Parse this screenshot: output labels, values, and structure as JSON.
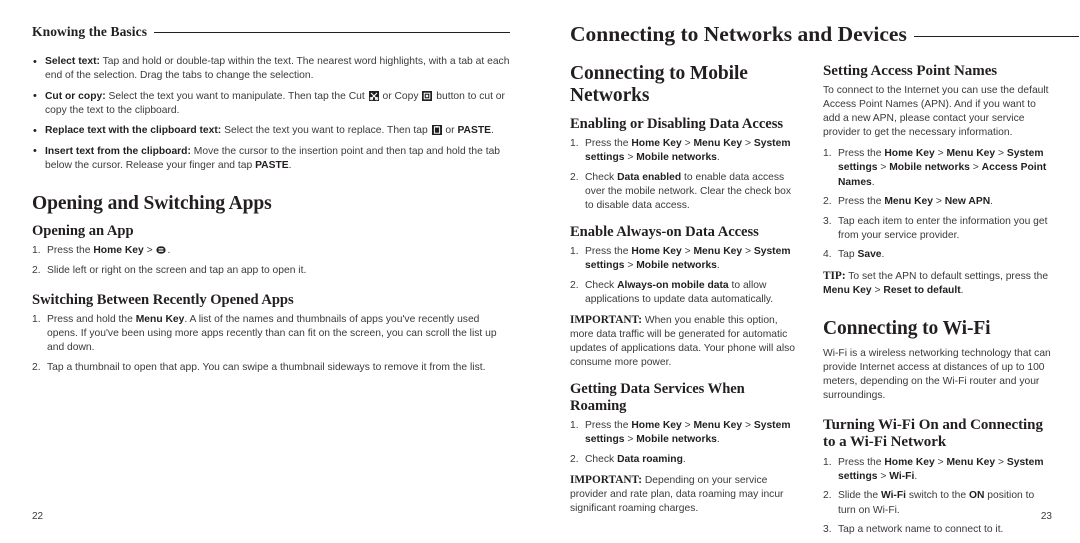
{
  "spread": {
    "left_page": {
      "running_head": "Knowing the Basics",
      "folio": "22",
      "bullets": [
        {
          "term": "Select text:",
          "text": " Tap and hold or double-tap within the text. The nearest word highlights, with a tab at each end of the selection. Drag the tabs to change the selection."
        },
        {
          "term": "Cut or copy:",
          "text": " Select the text you want to manipulate. Then tap the Cut ",
          "icon1": "cut-icon",
          "text2": " or Copy ",
          "icon2": "copy-icon",
          "text3": " button to cut or copy the text to the clipboard."
        },
        {
          "term": "Replace text with the clipboard text:",
          "text": " Select the text you want to replace. Then tap ",
          "icon1": "paste-icon",
          "text2": " or ",
          "bold_tail": "PASTE",
          "text3": "."
        },
        {
          "term": "Insert text from the clipboard:",
          "text": " Move the cursor to the insertion point and then tap and hold the tab below the cursor. Release your finger and tap ",
          "bold_tail": "PASTE",
          "text3": "."
        }
      ],
      "section_title": "Opening and Switching Apps",
      "sub1": {
        "title": "Opening an App",
        "step1_a": "Press the ",
        "step1_key": "Home Key",
        "step1_gt": " > ",
        "step1_icon": "app-drawer-icon",
        "step1_b": ".",
        "step2": "Slide left or right on the screen and tap an app to open it."
      },
      "sub2": {
        "title": "Switching Between Recently Opened Apps",
        "step1_a": "Press and hold the ",
        "step1_key": "Menu Key",
        "step1_b": ". A list of the names and thumbnails of apps you've recently used opens. If you've been using more apps recently than can fit on the screen, you can scroll the list up and down.",
        "step2": "Tap a thumbnail to open that app. You can swipe a thumbnail sideways to remove it from the list."
      }
    },
    "right_page": {
      "running_head": "Connecting to Networks and Devices",
      "folio": "23",
      "col_left": {
        "section_title": "Connecting to Mobile Networks",
        "sub1": {
          "title": "Enabling or Disabling Data Access",
          "step1": {
            "a": "Press the ",
            "k1": "Home Key",
            "g1": " > ",
            "k2": "Menu Key",
            "g2": " > ",
            "k3": "System settings",
            "g3": " > ",
            "k4": "Mobile networks",
            "b": "."
          },
          "step2": {
            "a": "Check ",
            "k1": "Data enabled",
            "b": " to enable data access over the mobile network. Clear the check box to disable data access."
          }
        },
        "sub2": {
          "title": "Enable Always-on Data Access",
          "step1": {
            "a": "Press the ",
            "k1": "Home Key",
            "g1": " > ",
            "k2": "Menu Key",
            "g2": " > ",
            "k3": "System settings",
            "g3": " > ",
            "k4": "Mobile networks",
            "b": "."
          },
          "step2": {
            "a": "Check ",
            "k1": "Always-on mobile data",
            "b": " to allow applications to update data automatically."
          },
          "note_lead": "IMPORTANT:",
          "note_text": " When you enable this option, more data traffic will be generated for automatic updates of applications data. Your phone will also consume more power."
        },
        "sub3": {
          "title": "Getting Data Services When Roaming",
          "step1": {
            "a": "Press the ",
            "k1": "Home Key",
            "g1": " > ",
            "k2": "Menu Key",
            "g2": " > ",
            "k3": "System settings",
            "g3": " > ",
            "k4": "Mobile networks",
            "b": "."
          },
          "step2": {
            "a": "Check ",
            "k1": "Data roaming",
            "b": "."
          },
          "note_lead": "IMPORTANT:",
          "note_text": " Depending on your service provider and rate plan, data roaming may incur significant roaming charges."
        }
      },
      "col_right": {
        "sub1": {
          "title": "Setting Access Point Names",
          "intro": "To connect to the Internet you can use the default Access Point Names (APN). And if you want to add a new APN, please contact your service provider to get the necessary information.",
          "step1": {
            "a": "Press the ",
            "k1": "Home Key",
            "g1": " > ",
            "k2": "Menu Key",
            "g2": " > ",
            "k3": "System settings",
            "g3": " > ",
            "k4": "Mobile networks",
            "g4": " > ",
            "k5": "Access Point Names",
            "b": "."
          },
          "step2": {
            "a": "Press the ",
            "k1": "Menu Key",
            "g1": " > ",
            "k2": "New APN",
            "b": "."
          },
          "step3": {
            "a": "Tap each item to enter the information you get from your service provider."
          },
          "step4": {
            "a": "Tap ",
            "k1": "Save",
            "b": "."
          },
          "tip_lead": "TIP:",
          "tip_text": " To set the APN to default settings, press the ",
          "tip_k1": "Menu Key",
          "tip_g1": " > ",
          "tip_k2": "Reset to default",
          "tip_tail": "."
        },
        "section_title": "Connecting to Wi-Fi",
        "section_intro": "Wi-Fi is a wireless networking technology that can provide Internet access at distances of up to 100 meters, depending on the Wi-Fi router and your surroundings.",
        "sub2": {
          "title": "Turning Wi-Fi On and Connecting to a Wi-Fi Network",
          "step1": {
            "a": "Press the ",
            "k1": "Home Key",
            "g1": " > ",
            "k2": "Menu Key",
            "g2": " > ",
            "k3": "System settings",
            "g3": " > ",
            "k4": "Wi-Fi",
            "b": "."
          },
          "step2": {
            "a": "Slide the ",
            "k1": "Wi-Fi",
            "m": " switch to the ",
            "k2": "ON",
            "b": " position to turn on Wi-Fi."
          },
          "step3": {
            "a": "Tap a network name to connect to it."
          }
        }
      }
    }
  },
  "colors": {
    "ink": "#231f20",
    "body_ink": "#3a3a3c",
    "paper": "#ffffff"
  }
}
